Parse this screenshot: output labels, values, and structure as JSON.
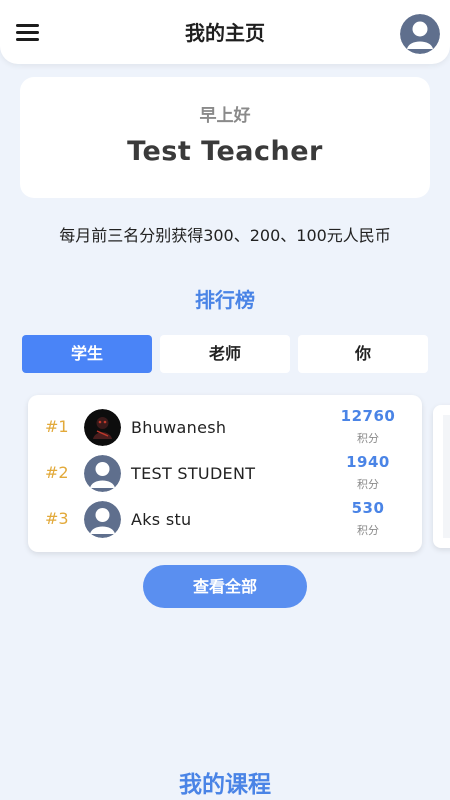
{
  "header": {
    "title": "我的主页",
    "menu_icon": "hamburger-menu-icon",
    "avatar_icon": "user-avatar-icon"
  },
  "greeting": {
    "subtitle": "早上好",
    "name": "Test Teacher"
  },
  "prize_text": "每月前三名分别获得300、200、100元人民币",
  "leaderboard": {
    "title": "排行榜",
    "tabs": [
      {
        "label": "学生",
        "active": true
      },
      {
        "label": "老师",
        "active": false
      },
      {
        "label": "你",
        "active": false
      }
    ],
    "rows": [
      {
        "rank": "#1",
        "name": "Bhuwanesh",
        "points": "12760",
        "unit": "积分",
        "avatar": "dark-photo-avatar"
      },
      {
        "rank": "#2",
        "name": "TEST STUDENT",
        "points": "1940",
        "unit": "积分",
        "avatar": "default-user-avatar"
      },
      {
        "rank": "#3",
        "name": "Aks stu",
        "points": "530",
        "unit": "积分",
        "avatar": "default-user-avatar"
      }
    ],
    "view_all_label": "查看全部"
  },
  "courses": {
    "title": "我的课程"
  },
  "colors": {
    "accent": "#4a84e6",
    "active_tab": "#4a84f7",
    "rank_gold": "#e2a93a",
    "background": "#eef3fb"
  }
}
